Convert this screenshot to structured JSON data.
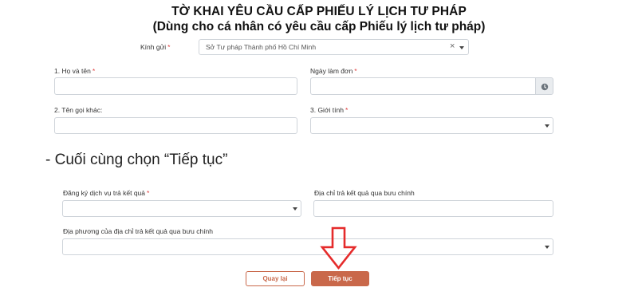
{
  "header": {
    "title": "TỜ KHAI YÊU CẦU CẤP PHIẾU LÝ LỊCH TƯ PHÁP",
    "subtitle": "(Dùng cho cá nhân có yêu cầu cấp Phiếu lý lịch tư pháp)"
  },
  "form": {
    "kinh_gui_label": "Kính gửi",
    "kinh_gui_value": "Sở Tư pháp Thành phố Hồ Chí Minh",
    "kinh_gui_clear": "×",
    "ho_ten_label": "1. Họ và tên",
    "ho_ten_value": "",
    "ngay_lam_don_label": "Ngày làm đơn",
    "ngay_lam_don_value": "",
    "ten_goi_khac_label": "2. Tên gọi khác:",
    "ten_goi_khac_value": "",
    "gioi_tinh_label": "3. Giới tính",
    "gioi_tinh_value": "",
    "required_mark": "*"
  },
  "instruction": "- Cuối cùng chọn “Tiếp tục”",
  "delivery": {
    "dang_ky_label": "Đăng ký dịch vụ trả kết quả",
    "dang_ky_value": "",
    "dia_chi_label": "Địa chỉ trả kết quả qua bưu chính",
    "dia_chi_value": "",
    "dia_phuong_label": "Địa phương của địa chỉ trả kết quả qua bưu chính",
    "dia_phuong_value": ""
  },
  "buttons": {
    "back_label": "Quay lại",
    "continue_label": "Tiếp tục"
  },
  "colors": {
    "primary": "#c9684a",
    "arrow": "#e52b2b",
    "required": "#e04040"
  },
  "icons": {
    "date": "clock-icon",
    "dropdown": "caret-down-icon",
    "pointer": "arrow-down-outline-icon"
  }
}
